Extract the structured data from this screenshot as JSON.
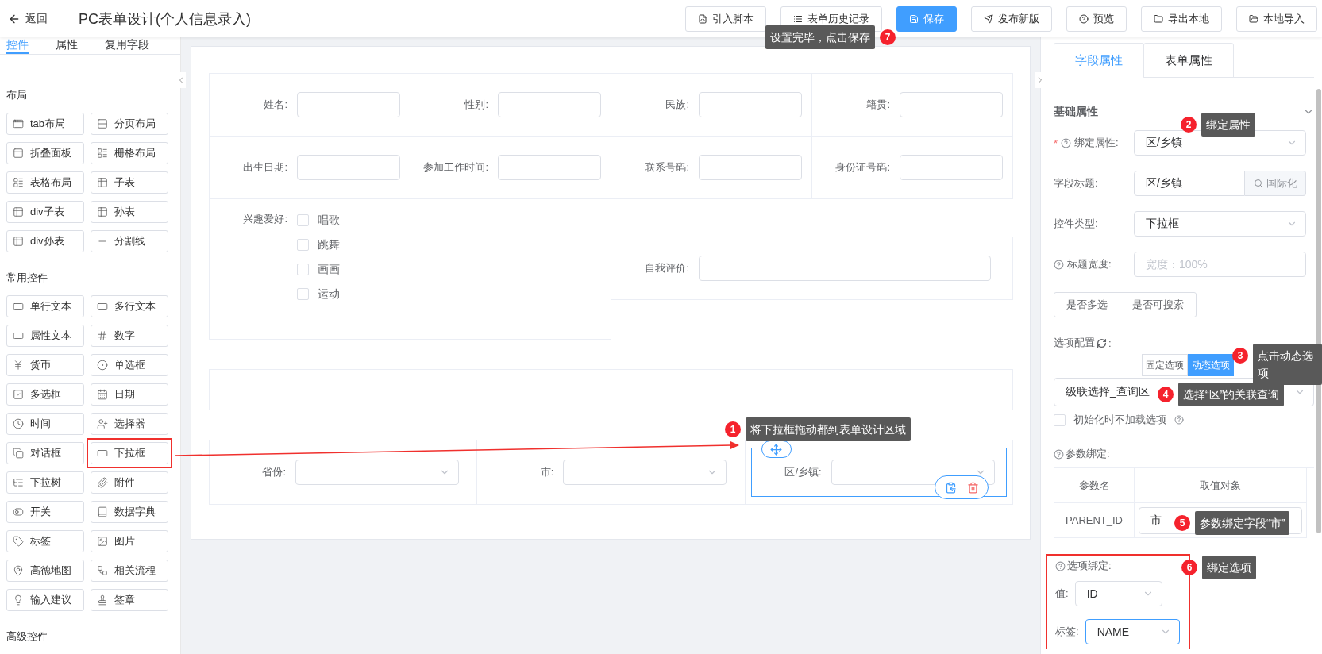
{
  "header": {
    "back_label": "返回",
    "title": "PC表单设计(个人信息录入)",
    "buttons": [
      {
        "label": "引入脚本",
        "primary": false
      },
      {
        "label": "表单历史记录",
        "primary": false
      },
      {
        "label": "保存",
        "primary": true
      },
      {
        "label": "发布新版",
        "primary": false
      },
      {
        "label": "预览",
        "primary": false
      },
      {
        "label": "导出本地",
        "primary": false
      },
      {
        "label": "本地导入",
        "primary": false
      }
    ]
  },
  "left_panel": {
    "tabs": [
      {
        "label": "控件",
        "selected": true
      },
      {
        "label": "属性",
        "selected": false
      },
      {
        "label": "复用字段",
        "selected": false
      }
    ],
    "sections": [
      {
        "title": "布局",
        "items": [
          {
            "label": "tab布局",
            "highlighted": false
          },
          {
            "label": "分页布局",
            "highlighted": false
          },
          {
            "label": "折叠面板",
            "highlighted": false
          },
          {
            "label": "栅格布局",
            "highlighted": false
          },
          {
            "label": "表格布局",
            "highlighted": false
          },
          {
            "label": "子表",
            "highlighted": false
          },
          {
            "label": "div子表",
            "highlighted": false
          },
          {
            "label": "孙表",
            "highlighted": false
          },
          {
            "label": "div孙表",
            "highlighted": false
          },
          {
            "label": "分割线",
            "highlighted": false
          }
        ]
      },
      {
        "title": "常用控件",
        "items": [
          {
            "label": "单行文本",
            "highlighted": false
          },
          {
            "label": "多行文本",
            "highlighted": false
          },
          {
            "label": "属性文本",
            "highlighted": false
          },
          {
            "label": "数字",
            "highlighted": false
          },
          {
            "label": "货币",
            "highlighted": false
          },
          {
            "label": "单选框",
            "highlighted": false
          },
          {
            "label": "多选框",
            "highlighted": false
          },
          {
            "label": "日期",
            "highlighted": false
          },
          {
            "label": "时间",
            "highlighted": false
          },
          {
            "label": "选择器",
            "highlighted": false
          },
          {
            "label": "对话框",
            "highlighted": false
          },
          {
            "label": "下拉框",
            "highlighted": true
          },
          {
            "label": "下拉树",
            "highlighted": false
          },
          {
            "label": "附件",
            "highlighted": false
          },
          {
            "label": "开关",
            "highlighted": false
          },
          {
            "label": "数据字典",
            "highlighted": false
          },
          {
            "label": "标签",
            "highlighted": false
          },
          {
            "label": "图片",
            "highlighted": false
          },
          {
            "label": "高德地图",
            "highlighted": false
          },
          {
            "label": "相关流程",
            "highlighted": false
          },
          {
            "label": "输入建议",
            "highlighted": false
          },
          {
            "label": "签章",
            "highlighted": false
          }
        ]
      },
      {
        "title": "高级控件"
      }
    ]
  },
  "form": {
    "rows": [
      {
        "kind": "inputs",
        "cells": [
          {
            "label": "姓名:"
          },
          {
            "label": "性别:"
          },
          {
            "label": "民族:"
          },
          {
            "label": "籍贯:"
          }
        ]
      },
      {
        "kind": "inputs",
        "cells": [
          {
            "label": "出生日期:"
          },
          {
            "label": "参加工作时间:"
          },
          {
            "label": "联系号码:"
          },
          {
            "label": "身份证号码:"
          }
        ]
      },
      {
        "kind": "mixed",
        "checkbox_group": {
          "label": "兴趣爱好:",
          "options": [
            {
              "label": "唱歌",
              "checked": false
            },
            {
              "label": "跳舞",
              "checked": false
            },
            {
              "label": "画画",
              "checked": false
            },
            {
              "label": "运动",
              "checked": false
            }
          ]
        },
        "field": {
          "label": "自我评价:"
        }
      },
      {
        "kind": "empty"
      },
      {
        "kind": "selects",
        "cells": [
          {
            "label": "省份:",
            "selected": false
          },
          {
            "label": "市:",
            "selected": false
          },
          {
            "label": "区/乡镇:",
            "selected": true
          }
        ]
      }
    ]
  },
  "right_panel": {
    "tabs": [
      {
        "label": "字段属性",
        "selected": true
      },
      {
        "label": "表单属性",
        "selected": false
      }
    ],
    "section_title": "基础属性",
    "fields": [
      {
        "kind": "select",
        "label": "绑定属性:",
        "required_mark": "*",
        "help": true,
        "value": "区/乡镇"
      },
      {
        "kind": "input-addon",
        "label": "字段标题:",
        "help": false,
        "value": "区/乡镇",
        "addon": "国际化"
      },
      {
        "kind": "select",
        "label": "控件类型:",
        "help": false,
        "value": "下拉框"
      },
      {
        "kind": "input",
        "label": "标题宽度:",
        "help": true,
        "placeholder": "宽度：100%"
      }
    ],
    "toggles": [
      {
        "label": "是否多选",
        "on": false
      },
      {
        "label": "是否可搜索",
        "on": false
      }
    ],
    "option_config": {
      "label": "选项配置",
      "label_suffix": ":",
      "modes": [
        {
          "label": "固定选项",
          "selected": false
        },
        {
          "label": "动态选项",
          "selected": true
        }
      ],
      "query": "级联选择_查询区",
      "lazy": {
        "label": "初始化时不加载选项",
        "checked": false
      }
    },
    "param_binding": {
      "label": "参数绑定:",
      "columns": [
        "参数名",
        "取值对象"
      ],
      "rows": [
        {
          "name": "PARENT_ID",
          "value": "市"
        }
      ]
    },
    "option_binding": {
      "label": "选项绑定:",
      "highlighted": true,
      "fields": [
        {
          "label": "值:",
          "value": "ID",
          "focused": false
        },
        {
          "label": "标签:",
          "value": "NAME",
          "focused": true
        }
      ]
    }
  },
  "callouts": [
    {
      "number": "1",
      "text": "将下拉框拖动都到表单设计区域"
    },
    {
      "number": "2",
      "text": "绑定属性"
    },
    {
      "number": "3",
      "text": "点击动态选项"
    },
    {
      "number": "4",
      "text": "选择“区”的关联查询"
    },
    {
      "number": "5",
      "text": "参数绑定字段“市”"
    },
    {
      "number": "6",
      "text": "绑定选项"
    },
    {
      "number": "7",
      "text": "设置完毕，点击保存"
    }
  ]
}
